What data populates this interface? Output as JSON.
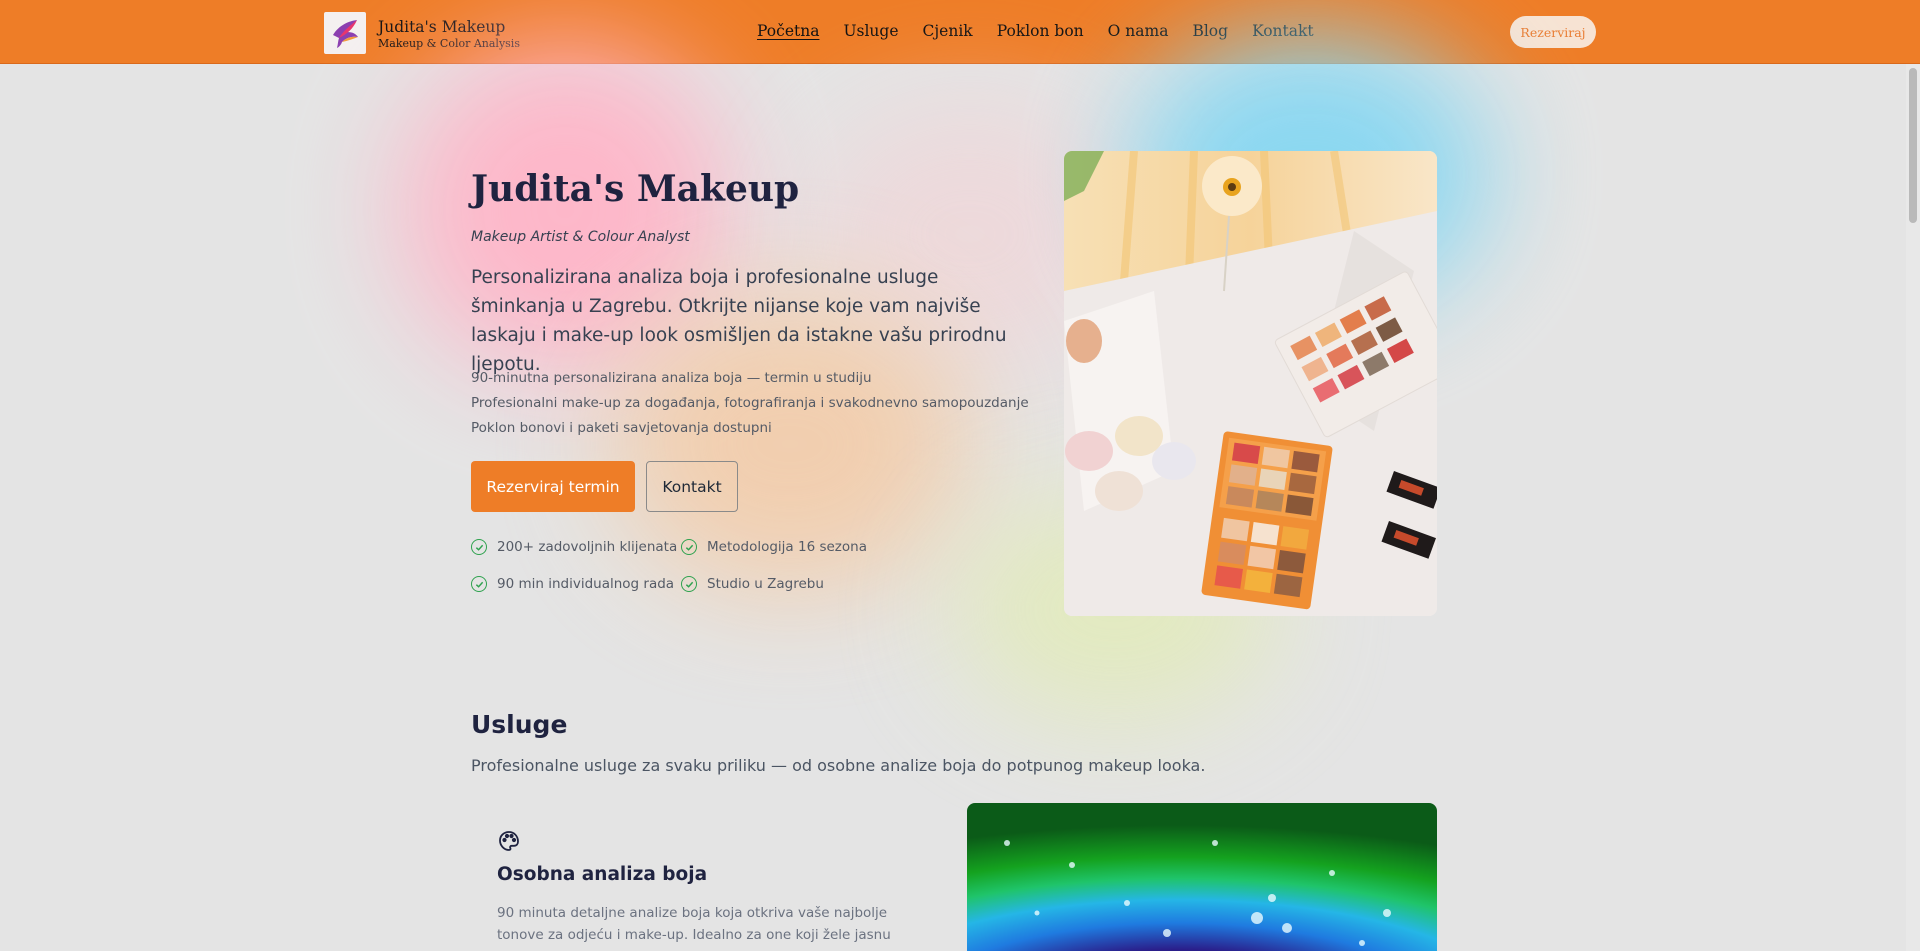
{
  "header": {
    "brand_title": "Judita's Makeup",
    "brand_subtitle": "Makeup & Color Analysis",
    "nav": [
      "Početna",
      "Usluge",
      "Cjenik",
      "Poklon bon",
      "O nama",
      "Blog",
      "Kontakt"
    ],
    "active_nav": "Početna",
    "cta_label": "Rezerviraj"
  },
  "hero": {
    "title": "Judita's Makeup",
    "subtitle": "Makeup Artist & Colour Analyst",
    "description": "Personalizirana analiza boja i profesionalne usluge šminkanja u Zagrebu. Otkrijte nijanse koje vam najviše laskaju i make-up look osmišljen da istakne vašu prirodnu ljepotu.",
    "bullets": [
      "90-minutna personalizirana analiza boja — termin u studiju",
      "Profesionalni make-up za događanja, fotografiranja i svakodnevno samopouzdanje",
      "Poklon bonovi i paketi savjetovanja dostupni"
    ],
    "primary_button": "Rezerviraj termin",
    "secondary_button": "Kontakt",
    "features": [
      "200+ zadovoljnih klijenata",
      "Metodologija 16 sezona",
      "90 min individualnog rada",
      "Studio u Zagrebu"
    ]
  },
  "services": {
    "title": "Usluge",
    "subtitle": "Profesionalne usluge za svaku priliku — od osobne analize boja do potpunog makeup looka.",
    "card": {
      "icon": "palette-icon",
      "title": "Osobna analiza boja",
      "description": "90 minuta detaljne analize boja koja otkriva vaše najbolje tonove za odjeću i make-up. Idealno za one koji žele jasnu paletu boja."
    }
  },
  "colors": {
    "header_bg": "#ee7d27",
    "accent": "#ee7d27",
    "check": "#2fa24f",
    "page_bg": "#e4e4e4"
  }
}
